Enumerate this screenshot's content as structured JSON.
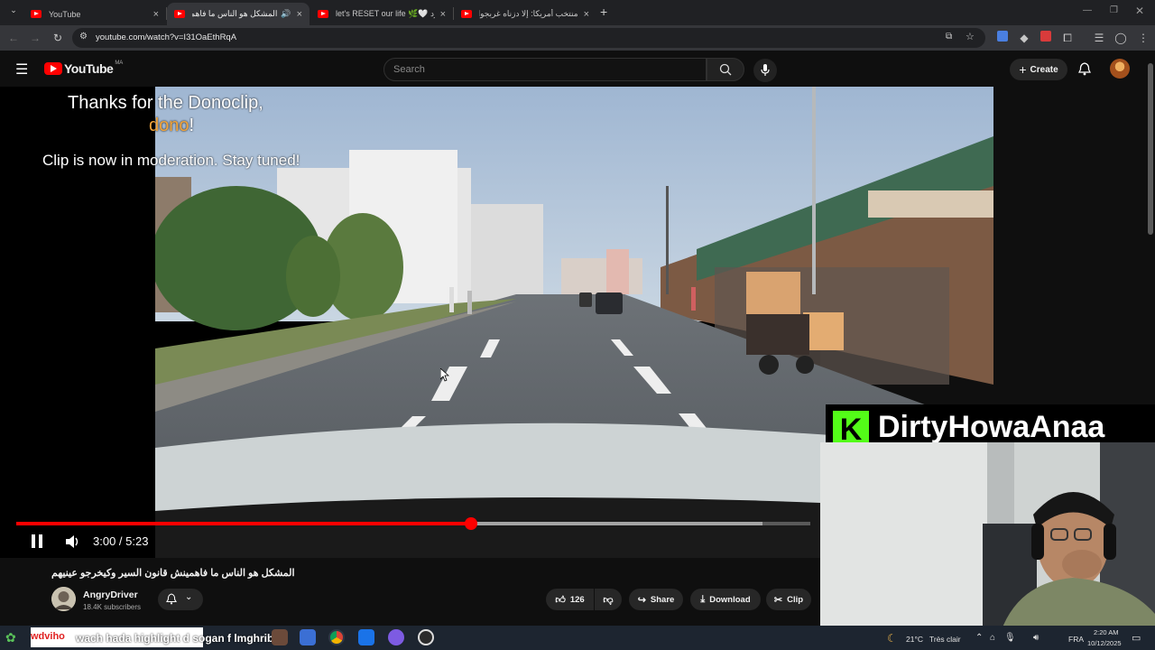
{
  "browser": {
    "tabs": [
      {
        "title": "YouTube",
        "close": "×"
      },
      {
        "title": "المشكل هو الناس ما فاهمينش",
        "close": "×"
      },
      {
        "title": "let's RESET our life 🌿🤍 البرد",
        "close": "×"
      },
      {
        "title": "منتخب أمريكا: إلا دزناه غربجوا الله",
        "close": "×"
      }
    ],
    "new_tab": "+",
    "url": "youtube.com/watch?v=I31OaEthRqA"
  },
  "youtube": {
    "logo_text": "YouTube",
    "logo_region": "MA",
    "search_placeholder": "Search",
    "create_label": "Create"
  },
  "overlay": {
    "thanks_line": "Thanks for the Donoclip,",
    "dono_word": "dono",
    "dono_suffix": "!",
    "moderation_line": "Clip is now in moderation. Stay tuned!",
    "streamer_initial": "K",
    "streamer_name": "DirtyHowaAnaa"
  },
  "player": {
    "time_display": "3:00 / 5:23",
    "progress_fraction": 0.573,
    "buffer_fraction": 0.94
  },
  "video": {
    "title": "المشكل هو الناس ما فاهمينش قانون السير وكيخرجو عينيهم",
    "channel": "AngryDriver",
    "subscribers": "18.4K subscribers",
    "likes": "126",
    "share_label": "Share",
    "download_label": "Download",
    "clip_label": "Clip"
  },
  "taskbar": {
    "ticker_prefix": "wdviho",
    "ticker_text": "wach hada highlight d sogan f lmghrib",
    "weather": "21°C",
    "weather_desc": "Très clair",
    "lang": "FRA",
    "time": "2:20 AM",
    "date": "10/12/2025"
  },
  "colors": {
    "accent_red": "#ff0000",
    "dono_gold": "#f2a43a",
    "kick_green": "#53fc18"
  }
}
